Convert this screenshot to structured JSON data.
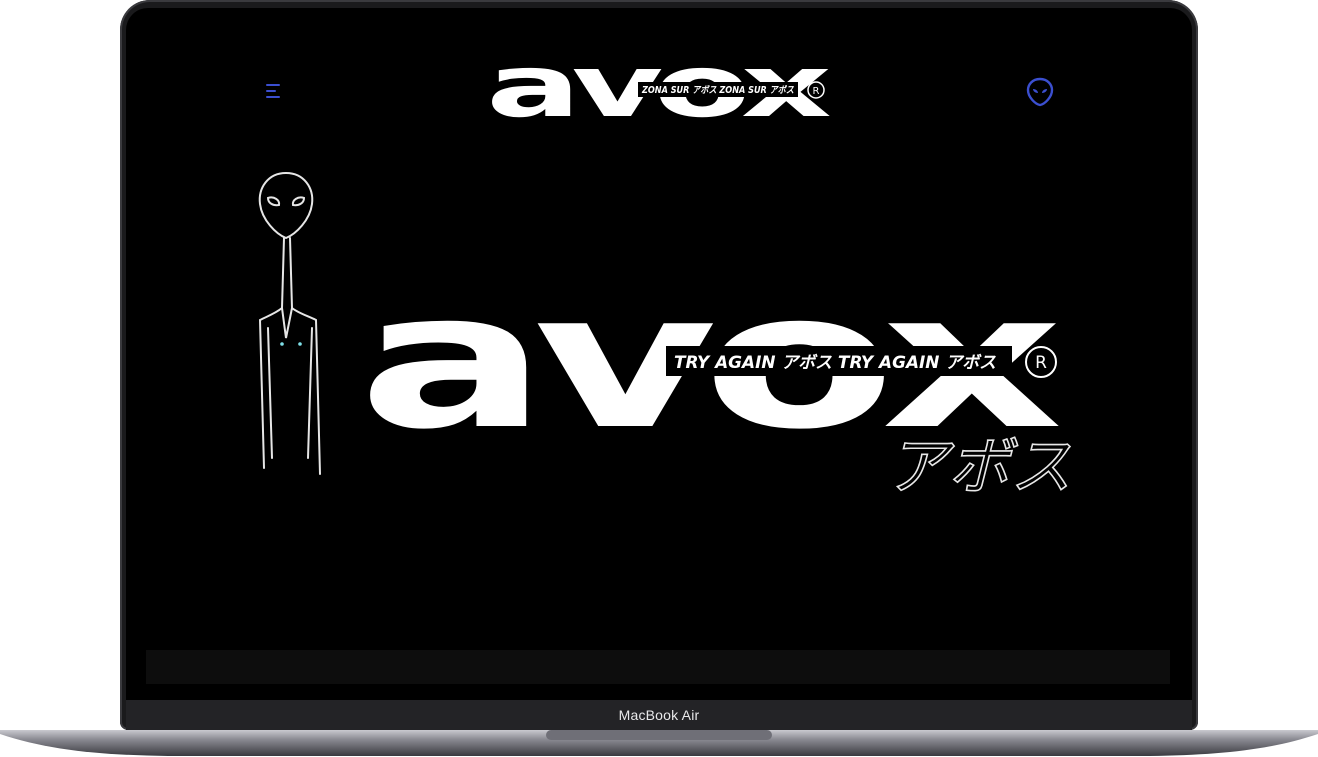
{
  "device": {
    "model_label": "MacBook Air"
  },
  "header": {
    "logo_word": "avox",
    "logo_strip_text": "ZONA SUR アボス ZONA SUR アボス",
    "registered_mark": "R"
  },
  "hero": {
    "logo_word": "avox",
    "strip_text": "TRY AGAIN アボス TRY AGAIN アボス",
    "registered_mark": "R",
    "katakana": "アボス"
  },
  "colors": {
    "accent": "#3b4fd0",
    "background": "#000000",
    "logo": "#ffffff"
  },
  "icons": {
    "menu": "hamburger-menu-icon",
    "user": "alien-head-icon"
  }
}
